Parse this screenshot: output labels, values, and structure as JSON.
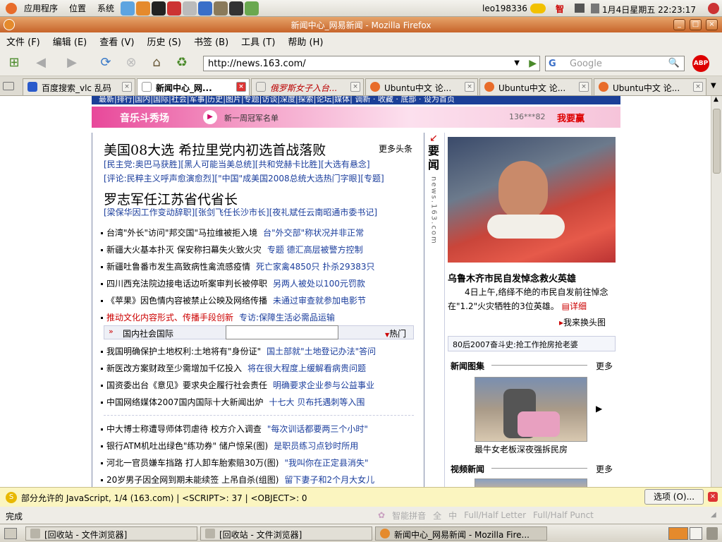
{
  "gnome": {
    "menus": [
      "应用程序",
      "位置",
      "系统"
    ],
    "user": "leo198336",
    "ime": "智",
    "datetime": "1月4日星期五 22:23:17"
  },
  "window": {
    "title": "新闻中心_网易新闻 - Mozilla Firefox"
  },
  "menubar": [
    "文件 (F)",
    "编辑 (E)",
    "查看 (V)",
    "历史 (S)",
    "书签 (B)",
    "工具 (T)",
    "帮助 (H)"
  ],
  "nav": {
    "url": "http://news.163.com/",
    "search_placeholder": "Google",
    "search_engine": "G"
  },
  "tabs": [
    {
      "label": "百度搜索_vlc 乱码"
    },
    {
      "label": "新闻中心_网..."
    },
    {
      "label": "俄罗斯女子入台..."
    },
    {
      "label": "Ubuntu中文 论..."
    },
    {
      "label": "Ubuntu中文 论..."
    },
    {
      "label": "Ubuntu中文 论..."
    }
  ],
  "page": {
    "topnav": "最新|排行|国内|国际|社会|军事|历史|图片|专题|访谈|深度|探索|论坛|媒体|          调新 · 收藏 · 底部 · 设为首页",
    "banner": {
      "logo": "音乐斗秀场",
      "text": "新一周冠军名单",
      "num": "136***82",
      "cta": "我要赢"
    },
    "headline1": "美国08大选  希拉里党内初选首战落败",
    "more_top": "更多头条",
    "links1": "[民主党:奥巴马获胜][黑人可能当美总统][共和党赫卡比胜][大选有悬念]",
    "links2": "[评论:民粹主义呼声愈演愈烈][\"中国\"成美国2008总统大选热门字眼][专题]",
    "headline2": "罗志军任江苏省代省长",
    "links3": "[梁保华因工作变动辞职][张剑飞任长沙市长][夜礼斌任云南昭通市委书记]",
    "news_group1": [
      {
        "main": "台湾\"外长\"访问\"邦交国\"马拉维被拒入境",
        "sub": "台\"外交部\"称状况并非正常"
      },
      {
        "main": "新疆大火基本扑灭  保安称扫幕失火致火灾",
        "sub": "专题  德汇高层被警方控制"
      },
      {
        "main": "新疆吐鲁番市发生高致病性禽流感疫情",
        "sub": "死亡家禽4850只  扑杀29383只"
      },
      {
        "main": "四川西充法院边接电话边听案审判长被停职",
        "sub": "另两人被处以100元罚款"
      },
      {
        "main": "《苹果》因色情内容被禁止公映及网络传播",
        "sub": "未通过审查就参加电影节"
      },
      {
        "main": "推动文化内容形式、传播手段创新",
        "sub": "专访:保障生活必需品运输"
      }
    ],
    "category_bar": {
      "label": "国内社会国际",
      "hot": "热门"
    },
    "news_group2": [
      {
        "main": "我国明确保护土地权利:土地将有\"身份证\"",
        "sub": "国土部就\"土地登记办法\"答问"
      },
      {
        "main": "新医改方案财政至少需增加千亿投入",
        "sub": "将在很大程度上缓解看病贵问题"
      },
      {
        "main": "国资委出台《意见》要求央企履行社会责任",
        "sub": "明确要求企业参与公益事业"
      },
      {
        "main": "中国网络媒体2007国内国际十大新闻出炉",
        "sub": "十七大  贝布托遇刺等入围"
      }
    ],
    "news_group3": [
      {
        "main": "中大博士称遭导师体罚虐待  校方介入调查",
        "sub": "\"每次训话都要两三个小时\""
      },
      {
        "main": "银行ATM机吐出绿色\"练功券\"  储户惊呆(图)",
        "sub": "是职员练习点钞时所用"
      },
      {
        "main": "河北一官员嫌车挡路  打人卸车胎索赔30万(图)",
        "sub": "\"我叫你在正定县消失\""
      },
      {
        "main": "20岁男子因全网到期未能续签  上吊自杀(组图)",
        "sub": "留下妻子和2个月大女儿"
      }
    ],
    "side_label": "要闻",
    "side_domain": "news.163.com",
    "photo_caption_title": "乌鲁木齐市民自发悼念救火英雄",
    "photo_caption_text": "4日上午,络绎不绝的市民自发前往悼念在\"1.2\"火灾牺牲的3位英雄。",
    "detail": "详细",
    "change_head": "我来换头图",
    "promo": "80后2007奋斗史:抢工作抢房抢老婆",
    "section_pics": "新闻图集",
    "more": "更多",
    "pic_caption": "最牛女老板深夜强拆民房",
    "section_video": "视频新闻"
  },
  "jsbar": {
    "text": "部分允许的 JavaScript, 1/4 (163.com) | <SCRIPT>: 37 | <OBJECT>: 0",
    "options": "选项 (O)..."
  },
  "status": {
    "text": "完成",
    "ime_items": [
      "智能拼音",
      "全",
      "中",
      "Full/Half Letter",
      "Full/Half Punct"
    ]
  },
  "taskbar": [
    {
      "label": "[回收站 - 文件浏览器]"
    },
    {
      "label": "[回收站 - 文件浏览器]"
    },
    {
      "label": "新闻中心_网易新闻 - Mozilla Fire..."
    }
  ]
}
